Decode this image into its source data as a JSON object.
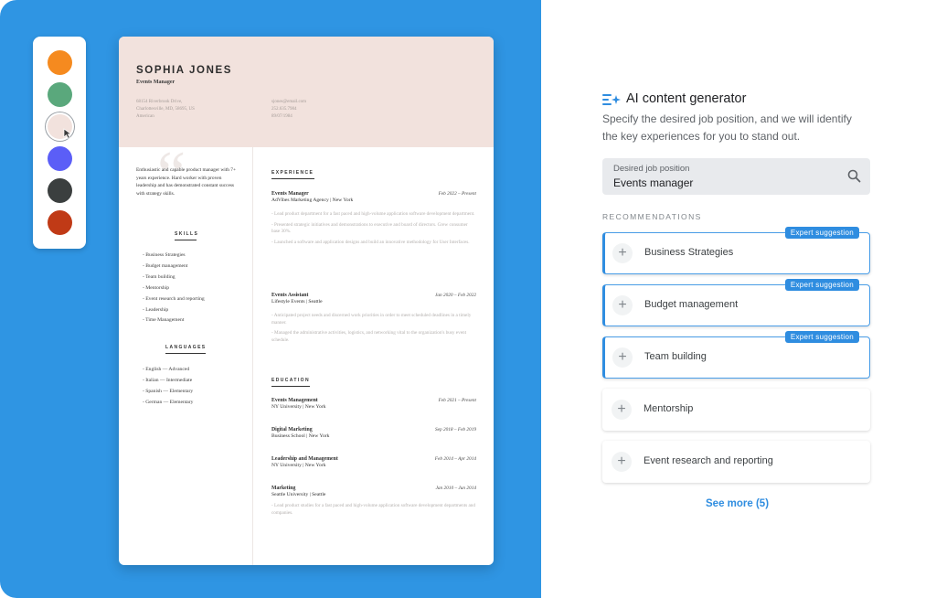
{
  "colors": {
    "palette": [
      "#f58a1f",
      "#5aa87c",
      "#f2e2dd",
      "#5b5ef7",
      "#3b3f3f",
      "#c03a16"
    ]
  },
  "resume": {
    "name": "SOPHIA JONES",
    "title": "Events Manager",
    "address": [
      "68154 Riverbrook Drive,",
      "Charlottesville, MD, 58695, US",
      "American"
    ],
    "contact": [
      "sjones@email.com",
      "252.635.7984",
      "89/07/1984"
    ],
    "summary": "Enthusiastic and capable product manager with 7+ years experience. Hard worker with proven leadership and has demonstrated constant success with strategy skills.",
    "skills_heading": "SKILLS",
    "skills": [
      "- Business Strategies",
      "- Budget management",
      "- Team building",
      "- Mentorship",
      "- Event research and reporting",
      "- Leadership",
      "- Time Management"
    ],
    "languages_heading": "LANGUAGES",
    "languages": [
      "- English — Advanced",
      "- Italian — Intermediate",
      "- Spanish — Elementary",
      "- German — Elementary"
    ],
    "experience_heading": "EXPERIENCE",
    "experience": [
      {
        "role": "Events Manager",
        "date": "Feb 2022 – Present",
        "org": "AdVibes Marketing Agency | New York",
        "bullets": [
          "- Lead product department for a fast paced and high-volume application software development department.",
          "- Presented strategic initiatives and demonstrations to executive and board of directors. Grew consumer base 30%.",
          "- Launched a software and application designs and build an innovative methodology for User Interfaces."
        ]
      },
      {
        "role": "Events Assistant",
        "date": "Jan 2020 – Feb 2022",
        "org": "Lifestyle Events | Seattle",
        "bullets": [
          "- Anticipated project needs and discerned work priorities in order to meet scheduled deadlines in a timely manner.",
          "- Managed the administrative activities, logistics, and networking vital to the organization's busy event schedule."
        ]
      }
    ],
    "education_heading": "EDUCATION",
    "education": [
      {
        "role": "Events Management",
        "date": "Feb 2021 – Present",
        "org": "NY University | New York"
      },
      {
        "role": "Digital Marketing",
        "date": "Sep 2018 – Feb 2019",
        "org": "Business School | New York"
      },
      {
        "role": "Leadership and Management",
        "date": "Feb 2014 – Apr 2014",
        "org": "NY University | New York"
      },
      {
        "role": "Marketing",
        "date": "Jan 2010 – Jun 2014",
        "org": "Seattle University | Seattle",
        "bullet": "- Lead product studies for a fast paced and high-volume application software development departments and companies."
      }
    ]
  },
  "ai": {
    "title": "AI content generator",
    "description": "Specify the desired job position, and we will identify the key experiences for you to stand out.",
    "search_label": "Desired job position",
    "search_value": "Events manager",
    "recommendations_label": "RECOMMENDATIONS",
    "badge_text": "Expert suggestion",
    "recommendations": [
      {
        "label": "Business Strategies",
        "expert": true
      },
      {
        "label": "Budget management",
        "expert": true
      },
      {
        "label": "Team building",
        "expert": true
      },
      {
        "label": "Mentorship",
        "expert": false
      },
      {
        "label": "Event research and reporting",
        "expert": false
      }
    ],
    "see_more": "See more (5)",
    "plus_symbol": "+"
  }
}
